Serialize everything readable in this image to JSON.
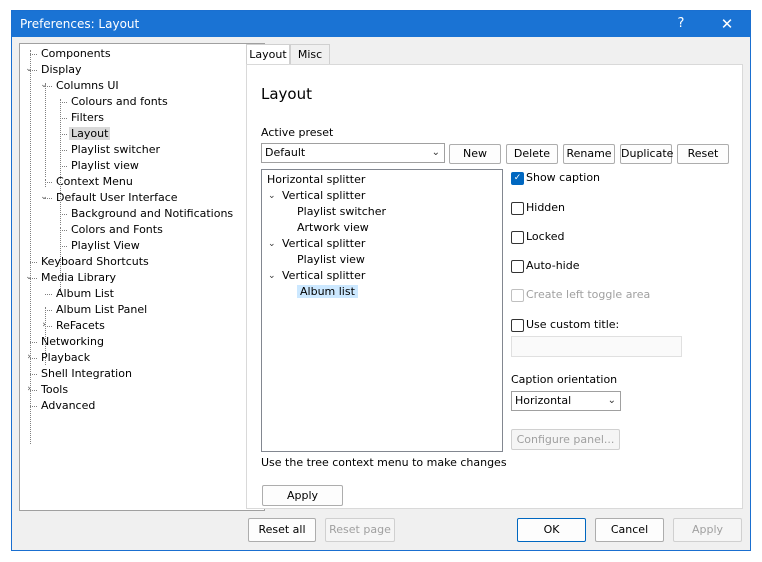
{
  "window": {
    "title": "Preferences: Layout",
    "help": "?",
    "close": "✕"
  },
  "tree": {
    "items": [
      {
        "label": "Components",
        "level": 0,
        "twisty": ""
      },
      {
        "label": "Display",
        "level": 0,
        "twisty": "⌄"
      },
      {
        "label": "Columns UI",
        "level": 1,
        "twisty": "⌄"
      },
      {
        "label": "Colours and fonts",
        "level": 2,
        "twisty": ""
      },
      {
        "label": "Filters",
        "level": 2,
        "twisty": ""
      },
      {
        "label": "Layout",
        "level": 2,
        "twisty": "",
        "selected": true
      },
      {
        "label": "Playlist switcher",
        "level": 2,
        "twisty": ""
      },
      {
        "label": "Playlist view",
        "level": 2,
        "twisty": ""
      },
      {
        "label": "Context Menu",
        "level": 1,
        "twisty": ""
      },
      {
        "label": "Default User Interface",
        "level": 1,
        "twisty": "⌄"
      },
      {
        "label": "Background and Notifications",
        "level": 2,
        "twisty": ""
      },
      {
        "label": "Colors and Fonts",
        "level": 2,
        "twisty": ""
      },
      {
        "label": "Playlist View",
        "level": 2,
        "twisty": ""
      },
      {
        "label": "Keyboard Shortcuts",
        "level": 0,
        "twisty": ""
      },
      {
        "label": "Media Library",
        "level": 0,
        "twisty": "⌄"
      },
      {
        "label": "Album List",
        "level": 1,
        "twisty": ""
      },
      {
        "label": "Album List Panel",
        "level": 1,
        "twisty": ""
      },
      {
        "label": "ReFacets",
        "level": 1,
        "twisty": "›"
      },
      {
        "label": "Networking",
        "level": 0,
        "twisty": ""
      },
      {
        "label": "Playback",
        "level": 0,
        "twisty": "›"
      },
      {
        "label": "Shell Integration",
        "level": 0,
        "twisty": ""
      },
      {
        "label": "Tools",
        "level": 0,
        "twisty": "›"
      },
      {
        "label": "Advanced",
        "level": 0,
        "twisty": ""
      }
    ]
  },
  "tabs": [
    {
      "label": "Layout",
      "active": true
    },
    {
      "label": "Misc",
      "active": false
    }
  ],
  "panel": {
    "heading": "Layout",
    "preset_label": "Active preset",
    "preset_value": "Default",
    "preset_buttons": [
      "New",
      "Delete",
      "Rename",
      "Duplicate",
      "Reset"
    ],
    "layout_tree": [
      {
        "text": "Horizontal splitter",
        "indent": 0,
        "chevron": ""
      },
      {
        "text": "Vertical splitter",
        "indent": 1,
        "chevron": "⌄"
      },
      {
        "text": "Playlist switcher",
        "indent": 2,
        "chevron": ""
      },
      {
        "text": "Artwork view",
        "indent": 2,
        "chevron": ""
      },
      {
        "text": "Vertical splitter",
        "indent": 1,
        "chevron": "⌄"
      },
      {
        "text": "Playlist view",
        "indent": 2,
        "chevron": ""
      },
      {
        "text": "Vertical splitter",
        "indent": 1,
        "chevron": "⌄"
      },
      {
        "text": "Album list",
        "indent": 2,
        "chevron": "",
        "selected": true
      }
    ],
    "hint": "Use the tree context menu to make changes",
    "apply": "Apply",
    "show_caption": "Show caption",
    "hidden": "Hidden",
    "locked": "Locked",
    "auto_hide": "Auto-hide",
    "create_left_toggle": "Create left toggle area",
    "use_custom_title": "Use custom title:",
    "caption_orientation_label": "Caption orientation",
    "caption_orientation_value": "Horizontal",
    "configure_panel": "Configure panel..."
  },
  "footer": {
    "reset_all": "Reset all",
    "reset_page": "Reset page",
    "ok": "OK",
    "cancel": "Cancel",
    "apply": "Apply"
  }
}
